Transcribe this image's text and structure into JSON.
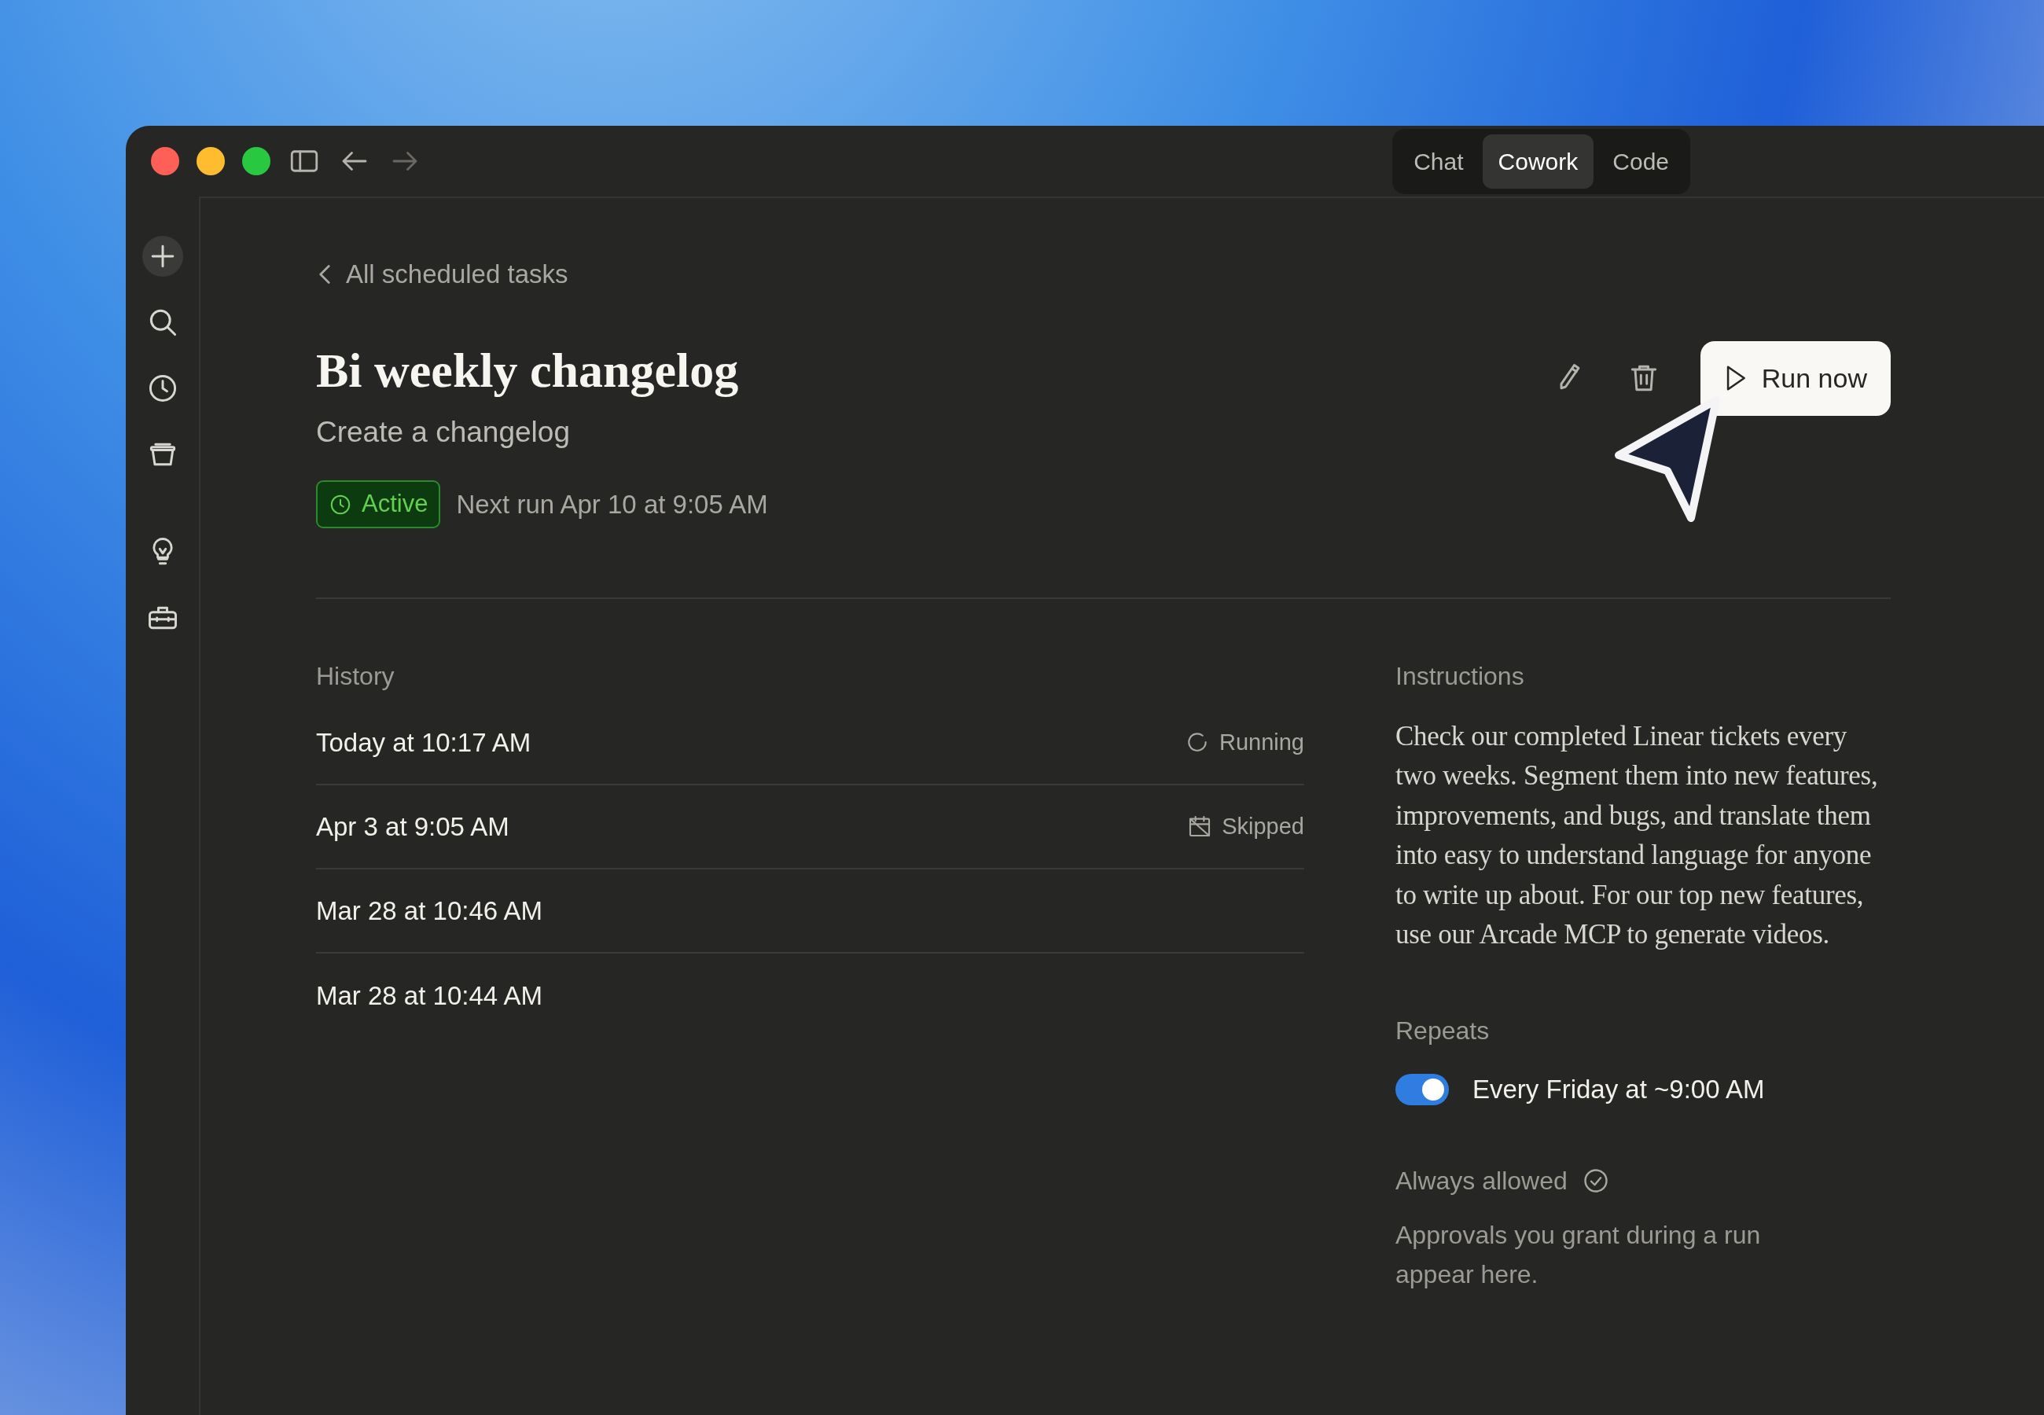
{
  "window": {
    "tabs": [
      {
        "label": "Chat",
        "selected": false
      },
      {
        "label": "Cowork",
        "selected": true
      },
      {
        "label": "Code",
        "selected": false
      }
    ]
  },
  "back_link": "All scheduled tasks",
  "task": {
    "title": "Bi weekly changelog",
    "subtitle": "Create a changelog",
    "status": "Active",
    "next_run": "Next run Apr 10 at 9:05 AM"
  },
  "run_button": "Run now",
  "history": {
    "heading": "History",
    "rows": [
      {
        "time": "Today at 10:17 AM",
        "kind": "running",
        "status": "Running"
      },
      {
        "time": "Apr 3 at 9:05 AM",
        "kind": "skipped",
        "status": "Skipped"
      },
      {
        "time": "Mar 28 at 10:46 AM"
      },
      {
        "time": "Mar 28 at 10:44 AM"
      }
    ]
  },
  "instructions": {
    "heading": "Instructions",
    "text": "Check our completed Linear tickets every two weeks. Segment them into new features, improvements, and bugs, and translate them into easy to understand language for anyone to write up about. For our top new features, use our Arcade MCP to generate videos."
  },
  "repeats": {
    "heading": "Repeats",
    "on": true,
    "schedule": "Every Friday at ~9:00 AM"
  },
  "always_allowed": {
    "heading": "Always allowed",
    "note": "Approvals you grant during a run appear here."
  }
}
